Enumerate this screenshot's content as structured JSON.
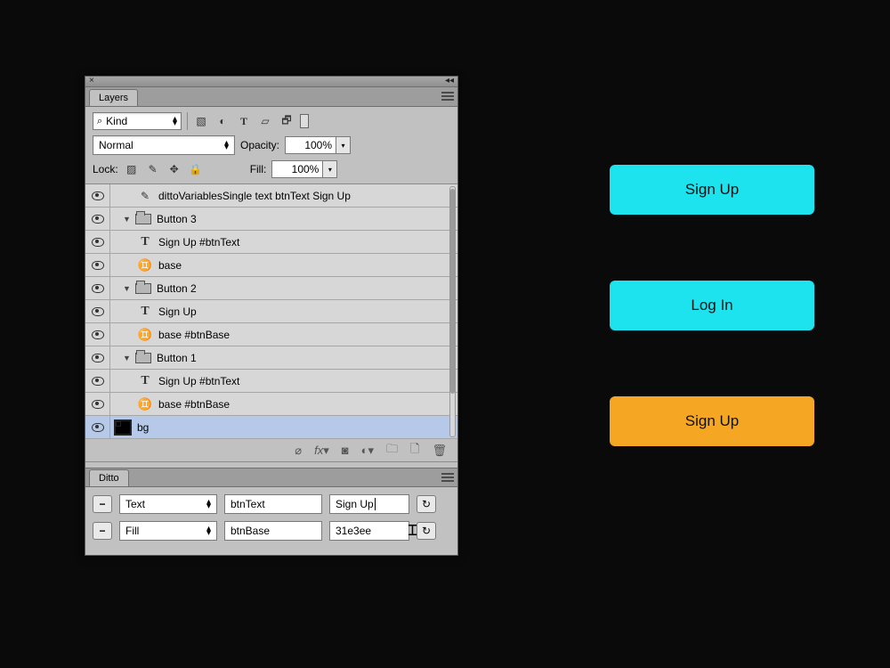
{
  "layers_panel": {
    "tab": "Layers",
    "filter": {
      "kind": "Kind"
    },
    "blend": {
      "mode": "Normal",
      "opacity_label": "Opacity:",
      "opacity": "100%"
    },
    "lock": {
      "label": "Lock:",
      "fill_label": "Fill:",
      "fill": "100%"
    },
    "items": [
      {
        "name": "dittoVariablesSingle text btnText Sign Up"
      },
      {
        "name": "Button 3"
      },
      {
        "name": "Sign Up #btnText"
      },
      {
        "name": "base"
      },
      {
        "name": "Button 2"
      },
      {
        "name": "Sign Up"
      },
      {
        "name": "base #btnBase"
      },
      {
        "name": "Button 1"
      },
      {
        "name": "Sign Up #btnText"
      },
      {
        "name": "base #btnBase"
      },
      {
        "name": "bg"
      }
    ]
  },
  "ditto_panel": {
    "tab": "Ditto",
    "rows": [
      {
        "type": "Text",
        "name": "btnText",
        "value": "Sign Up"
      },
      {
        "type": "Fill",
        "name": "btnBase",
        "value": "31e3ee"
      }
    ]
  },
  "canvas": {
    "buttons": [
      {
        "label": "Sign Up"
      },
      {
        "label": "Log In"
      },
      {
        "label": "Sign Up"
      }
    ]
  }
}
